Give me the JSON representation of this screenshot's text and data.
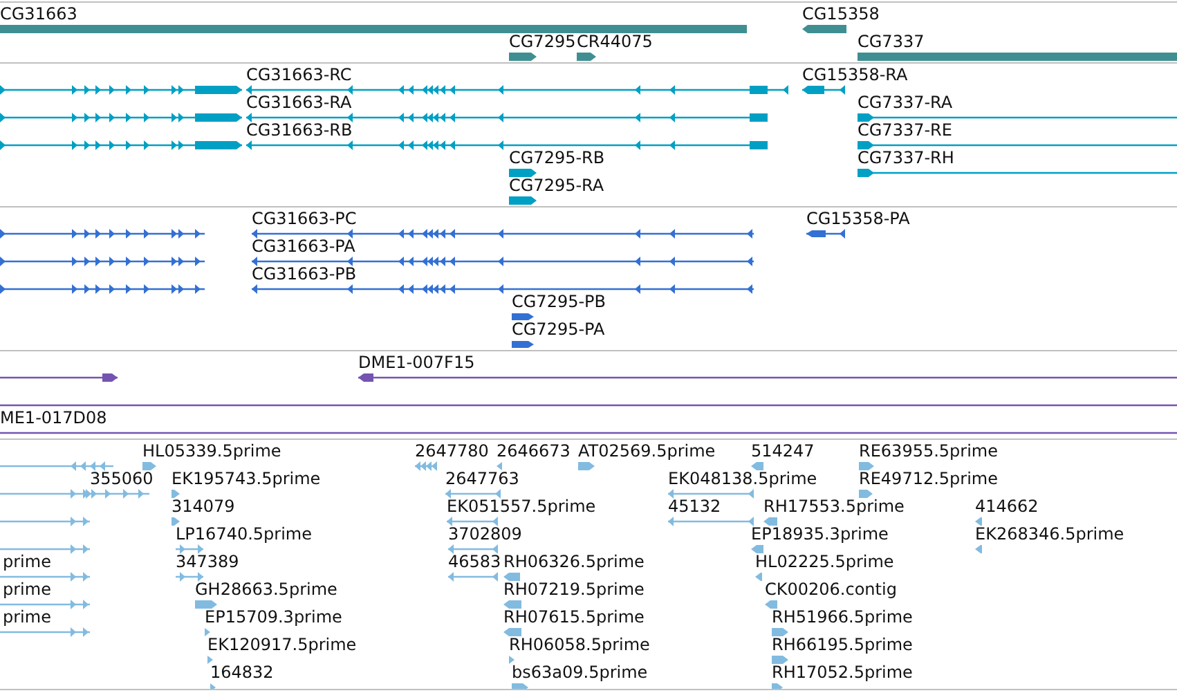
{
  "tracks": [
    {
      "kind": "genes",
      "color": "#3f8f92",
      "features": [
        {
          "label": "CG31663"
        },
        {
          "label": "CG15358",
          "reverse": true
        },
        {
          "label": "CG7295",
          "reverse": false
        },
        {
          "label": "CR44075",
          "reverse": false
        },
        {
          "label": "CG7337"
        }
      ]
    },
    {
      "kind": "transcripts",
      "color": "#00a0c4",
      "features": [
        {
          "reverse": false
        },
        {
          "label": "CG31663-RC",
          "reverse": true
        },
        {
          "label": "CG15358-RA",
          "reverse": true
        },
        {
          "reverse": false
        },
        {
          "label": "CG31663-RA",
          "reverse": true
        },
        {
          "label": "CG7337-RA",
          "reverse": false
        },
        {
          "reverse": false
        },
        {
          "label": "CG31663-RB",
          "reverse": true
        },
        {
          "label": "CG7337-RE",
          "reverse": false
        },
        {
          "label": "CG7295-RB",
          "reverse": false
        },
        {
          "label": "CG7337-RH",
          "reverse": false
        },
        {
          "label": "CG7295-RA",
          "reverse": false
        }
      ]
    },
    {
      "kind": "proteins",
      "color": "#3370d4",
      "features": [
        {
          "reverse": false
        },
        {
          "label": "CG31663-PC",
          "reverse": true
        },
        {
          "label": "CG15358-PA",
          "reverse": true
        },
        {
          "reverse": false
        },
        {
          "label": "CG31663-PA",
          "reverse": true
        },
        {
          "reverse": false
        },
        {
          "label": "CG31663-PB",
          "reverse": true
        },
        {
          "label": "CG7295-PB",
          "reverse": false
        },
        {
          "label": "CG7295-PA",
          "reverse": false
        }
      ]
    },
    {
      "kind": "clones",
      "color": "#7454b0",
      "features": [
        {
          "kind": "pointed",
          "reverse": false
        },
        {
          "kind": "pointed",
          "label": "DME1-007F15",
          "reverse": true
        },
        {
          "kind": "span"
        },
        {
          "kind": "span",
          "label": "ME1-017D08"
        }
      ]
    },
    {
      "kind": "ests",
      "color": "#82bbe0",
      "features": [
        {
          "reverse": true
        },
        {
          "label": "HL05339.5prime",
          "reverse": false
        },
        {
          "label": "2647780",
          "reverse": true
        },
        {
          "label": "2646673",
          "reverse": true
        },
        {
          "label": "AT02569.5prime",
          "reverse": false
        },
        {
          "label": "514247",
          "reverse": true
        },
        {
          "label": "RE63955.5prime",
          "reverse": false
        },
        {
          "label": "355060",
          "reverse": false
        },
        {
          "label": "EK195743.5prime",
          "reverse": false
        },
        {
          "label": "2647763",
          "reverse": true
        },
        {
          "label": "EK048138.5prime",
          "reverse": true
        },
        {
          "label": "RE49712.5prime",
          "reverse": false
        },
        {
          "reverse": false
        },
        {
          "label": "314079",
          "reverse": false
        },
        {
          "label": "EK051557.5prime",
          "reverse": true
        },
        {
          "label": "45132",
          "reverse": true
        },
        {
          "label": "RH17553.5prime",
          "reverse": true
        },
        {
          "label": "414662",
          "reverse": true
        },
        {
          "reverse": false
        },
        {
          "label": "LP16740.5prime",
          "reverse": false
        },
        {
          "label": "3702809",
          "reverse": true
        },
        {
          "label": "EP18935.3prime",
          "reverse": true
        },
        {
          "label": "EK268346.5prime",
          "reverse": true
        },
        {
          "label": "prime",
          "reverse": false
        },
        {
          "label": "347389",
          "reverse": false
        },
        {
          "label": "46583",
          "reverse": true
        },
        {
          "label": "RH06326.5prime",
          "reverse": true
        },
        {
          "label": "HL02225.5prime",
          "reverse": true
        },
        {
          "label": "prime",
          "reverse": false
        },
        {
          "label": "GH28663.5prime",
          "reverse": false
        },
        {
          "label": "RH07219.5prime",
          "reverse": true
        },
        {
          "label": "CK00206.contig",
          "reverse": true
        },
        {
          "label": "prime",
          "reverse": false
        },
        {
          "label": "EP15709.3prime",
          "reverse": false
        },
        {
          "label": "RH07615.5prime",
          "reverse": true
        },
        {
          "label": "RH51966.5prime",
          "reverse": false
        },
        {
          "label": "EK120917.5prime",
          "reverse": false
        },
        {
          "label": "RH06058.5prime",
          "reverse": false
        },
        {
          "label": "RH66195.5prime",
          "reverse": false
        },
        {
          "label": "164832",
          "reverse": false
        },
        {
          "label": "bs63a09.5prime",
          "reverse": false
        },
        {
          "label": "RH17052.5prime",
          "reverse": false
        }
      ]
    }
  ]
}
